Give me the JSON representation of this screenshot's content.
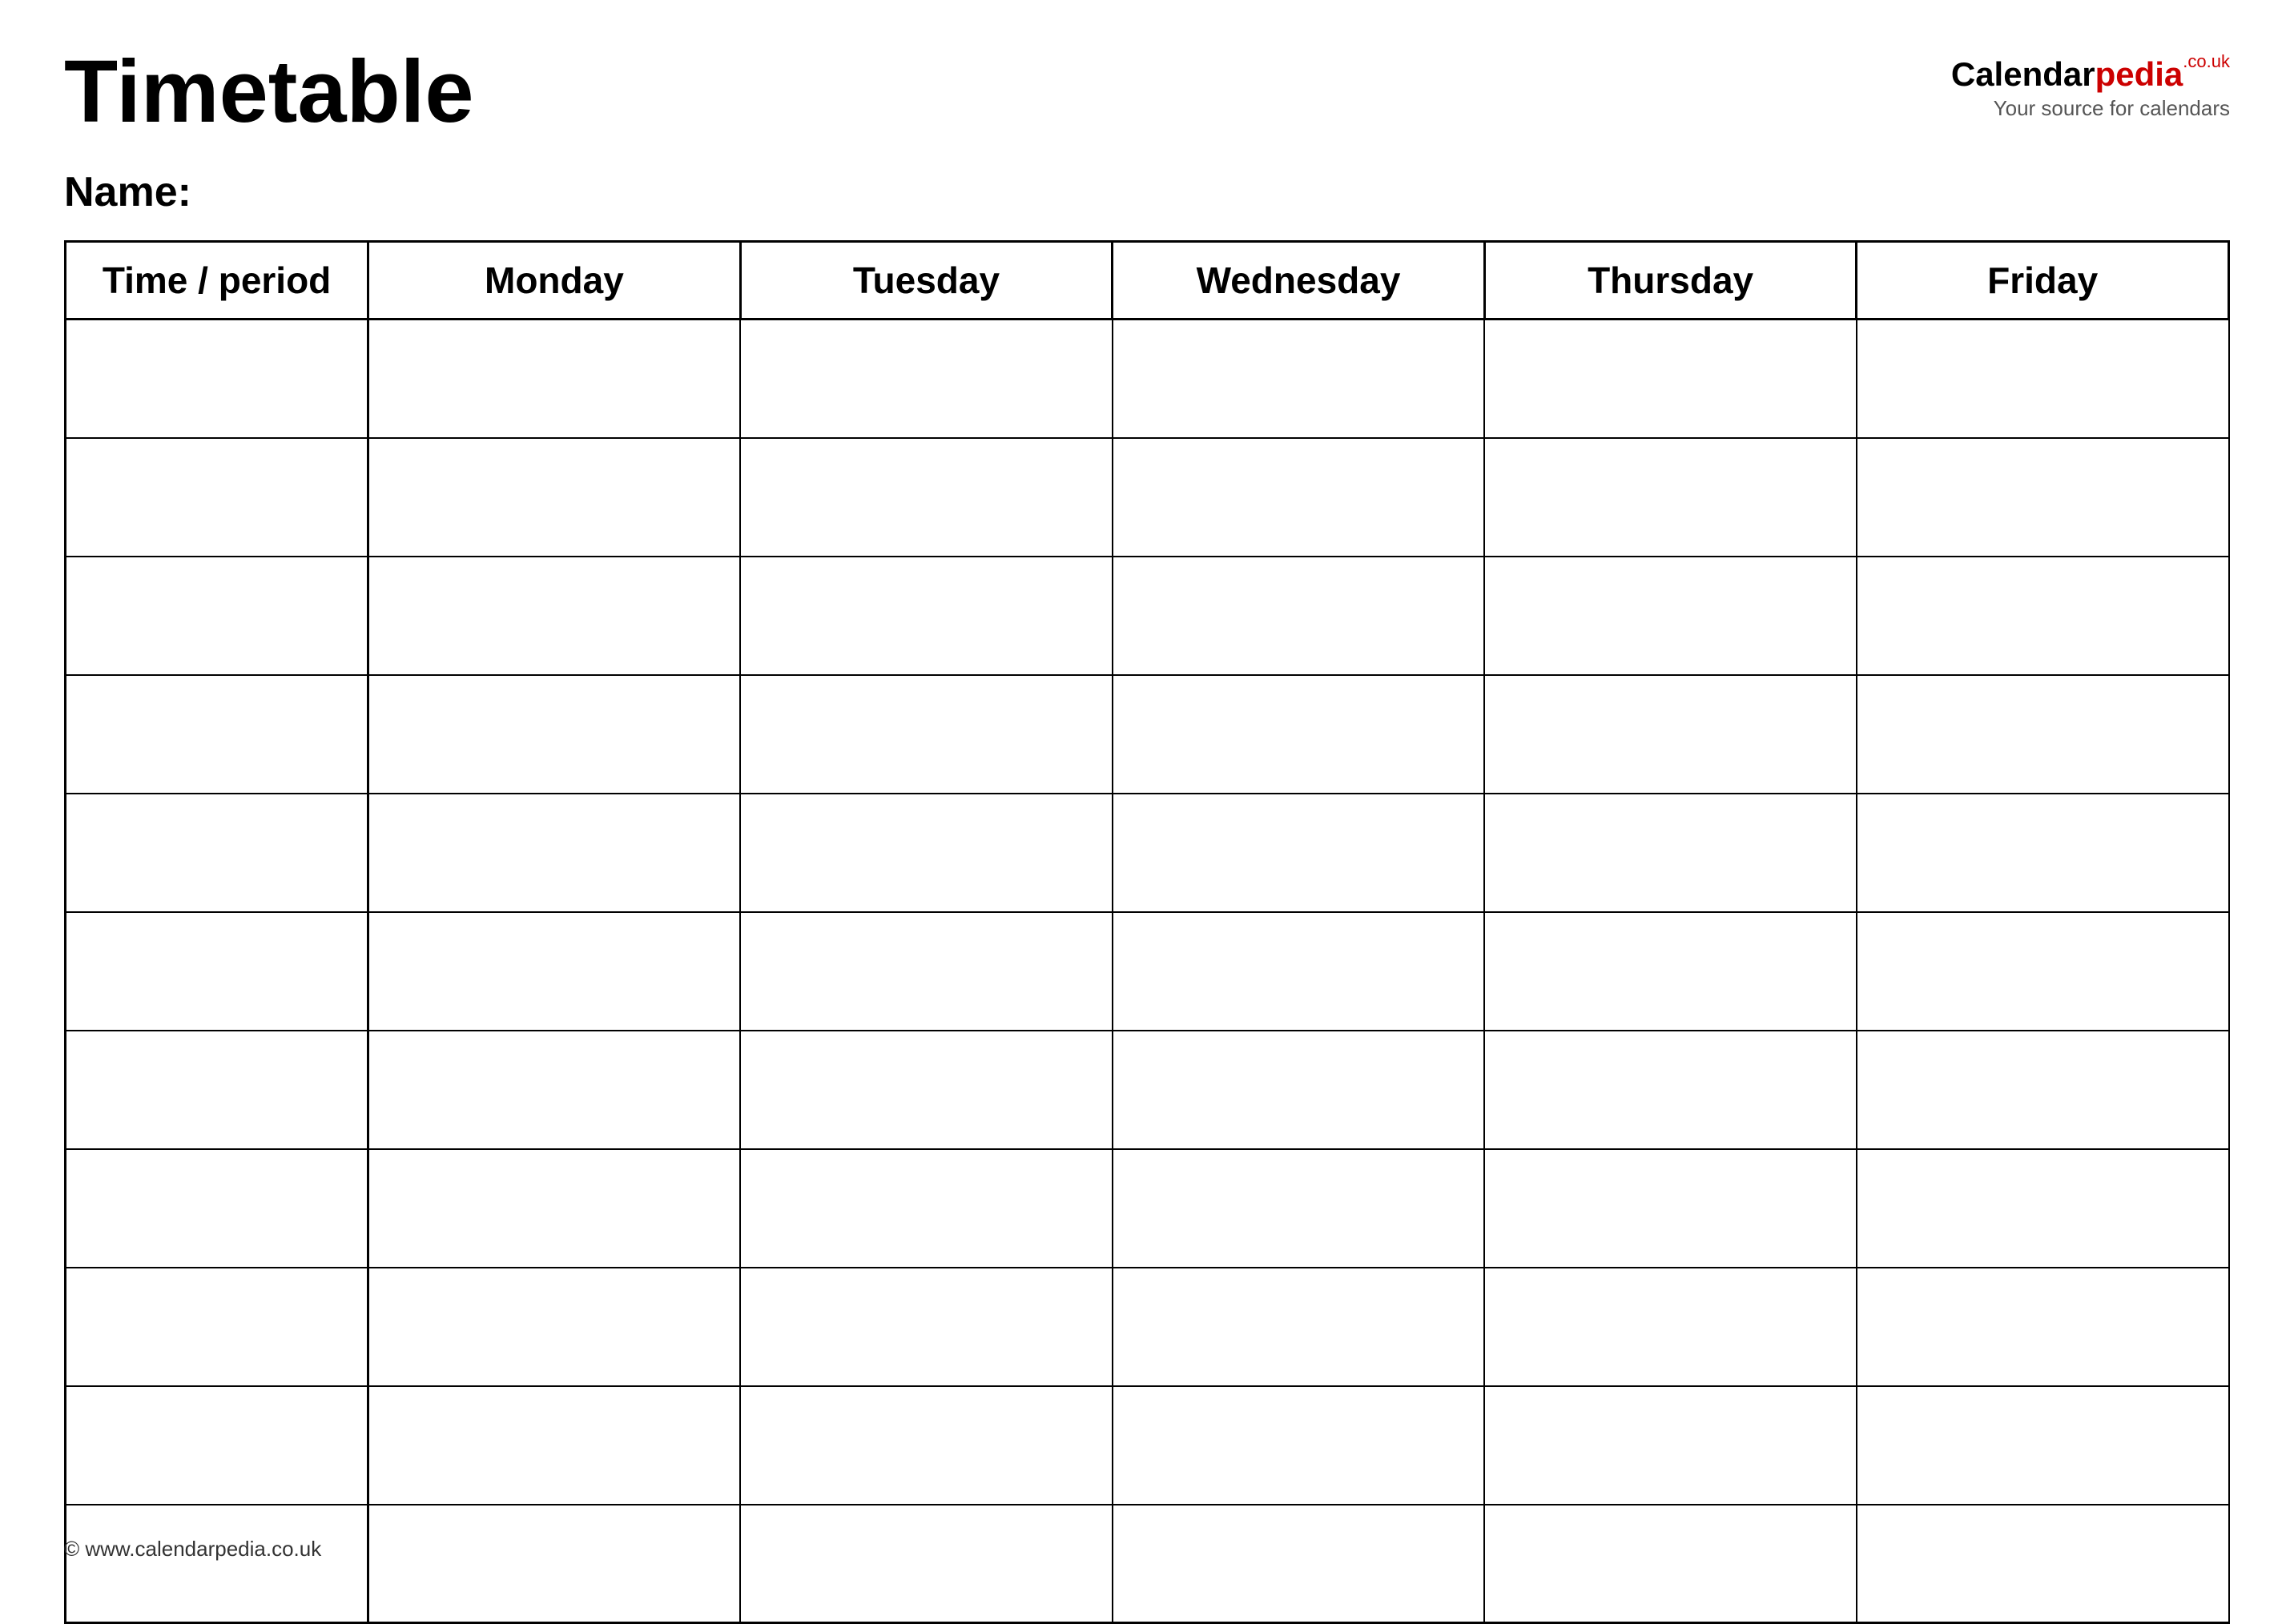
{
  "header": {
    "title": "Timetable",
    "logo": {
      "calendar_part": "Calendar",
      "pedia_part": "pedia",
      "couk": ".co.uk",
      "tagline": "Your source for calendars"
    }
  },
  "name_label": "Name:",
  "table": {
    "columns": [
      {
        "label": "Time / period"
      },
      {
        "label": "Monday"
      },
      {
        "label": "Tuesday"
      },
      {
        "label": "Wednesday"
      },
      {
        "label": "Thursday"
      },
      {
        "label": "Friday"
      }
    ],
    "rows": 11
  },
  "footer": {
    "url": "© www.calendarpedia.co.uk"
  }
}
